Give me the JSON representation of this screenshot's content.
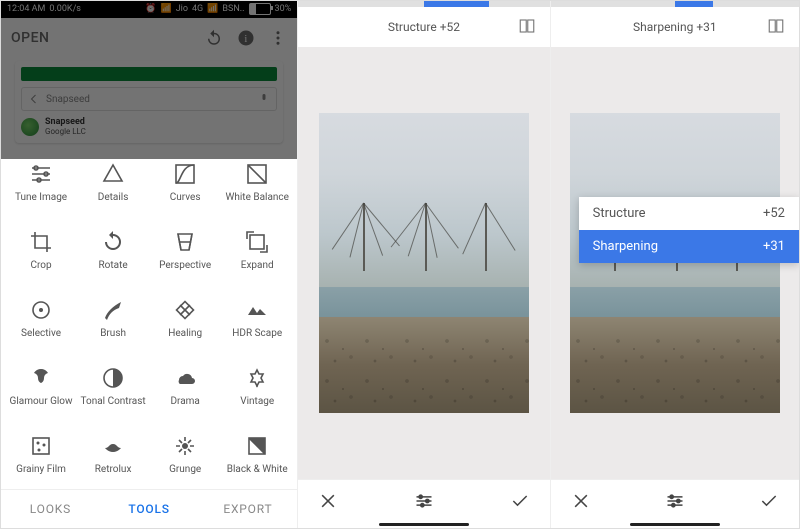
{
  "status": {
    "time": "12:04 AM",
    "speed": "0.00K/s",
    "net1": "Jio",
    "net1type": "4G",
    "net2": "BSN..",
    "battery": "30%"
  },
  "appbar": {
    "open": "OPEN"
  },
  "playstore": {
    "search": "Snapseed",
    "appname": "Snapseed",
    "appmeta": "Google LLC"
  },
  "tools": [
    {
      "label": "Tune Image",
      "icon": "tune"
    },
    {
      "label": "Details",
      "icon": "details"
    },
    {
      "label": "Curves",
      "icon": "curves"
    },
    {
      "label": "White Balance",
      "icon": "wb"
    },
    {
      "label": "Crop",
      "icon": "crop"
    },
    {
      "label": "Rotate",
      "icon": "rotate"
    },
    {
      "label": "Perspective",
      "icon": "perspective"
    },
    {
      "label": "Expand",
      "icon": "expand"
    },
    {
      "label": "Selective",
      "icon": "selective"
    },
    {
      "label": "Brush",
      "icon": "brush"
    },
    {
      "label": "Healing",
      "icon": "healing"
    },
    {
      "label": "HDR Scape",
      "icon": "hdr"
    },
    {
      "label": "Glamour Glow",
      "icon": "glow"
    },
    {
      "label": "Tonal Contrast",
      "icon": "tonal"
    },
    {
      "label": "Drama",
      "icon": "drama"
    },
    {
      "label": "Vintage",
      "icon": "vintage"
    },
    {
      "label": "Grainy Film",
      "icon": "grainy"
    },
    {
      "label": "Retrolux",
      "icon": "retro"
    },
    {
      "label": "Grunge",
      "icon": "grunge"
    },
    {
      "label": "Black & White",
      "icon": "bw"
    }
  ],
  "tabs": {
    "looks": "LOOKS",
    "tools": "TOOLS",
    "export": "EXPORT"
  },
  "panel2": {
    "label": "Structure",
    "value": "+52",
    "pct": 52
  },
  "panel3": {
    "label": "Sharpening",
    "value": "+31",
    "pct": 31,
    "menu": [
      {
        "name": "Structure",
        "val": "+52",
        "sel": false
      },
      {
        "name": "Sharpening",
        "val": "+31",
        "sel": true
      }
    ]
  }
}
